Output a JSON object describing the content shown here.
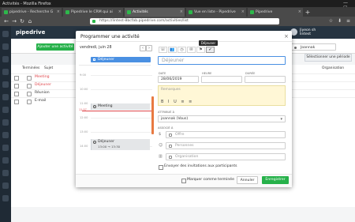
{
  "window": {
    "title": "Activités - Mozilla Firefox",
    "controls": "— ▢ ✕"
  },
  "tabs": [
    {
      "label": "pipedrive - Recherche G"
    },
    {
      "label": "Pipedrive le CRM qui ai"
    },
    {
      "label": "Activités"
    },
    {
      "label": "Vue en liste - Pipedrive"
    },
    {
      "label": "Pipedrive"
    }
  ],
  "url": "https://lintest-8bcfab.pipedrive.com/activities/list",
  "nav": {
    "back": "←",
    "forward": "→",
    "reload": "↻",
    "home": "⌂",
    "tools": "☆ ⬇ ≡"
  },
  "app": {
    "logo": "pipedrive",
    "user": {
      "name": "Jiyeon sh",
      "company": "lintest"
    },
    "add_activity": "Ajouter une activité",
    "filter_label": "Joannak",
    "period_label": "Sélectionner une période",
    "columns": {
      "done": "Terminées",
      "subject": "Sujet",
      "org": "Organisation"
    },
    "rows": [
      {
        "subject": "Meeting",
        "red": true
      },
      {
        "subject": "Déjeuner",
        "red": true
      },
      {
        "subject": "Réunion",
        "red": false
      },
      {
        "subject": "E-mail",
        "red": false
      }
    ]
  },
  "modal": {
    "title": "Programmer une activité",
    "close": "×",
    "date_label": "vendredi, juin 28",
    "prev": "‹",
    "next": "›",
    "allday_event": "Déjeuner",
    "hours": [
      "9:00",
      "10:00",
      "11:00",
      "12:00",
      "13:00",
      "14:00"
    ],
    "now_label": "11:57",
    "events": [
      {
        "title": "Meeting"
      },
      {
        "title": "Déjeuner",
        "time": "13:00 → 13:30"
      }
    ],
    "tooltip": "Déjeuner",
    "types": [
      "☏",
      "👥",
      "◷",
      "✉",
      "⚑",
      "✔"
    ],
    "subject_placeholder": "Déjeuner",
    "date_field_label": "DATE",
    "date_value": "28/06/2019",
    "time_field_label": "HEURE",
    "duration_field_label": "DURÉE",
    "notes_placeholder": "Remarques",
    "format_tools": "B I U ≡ ≡",
    "assigned_label": "ATTRIBUÉ À",
    "owner": "joannak (Vous)",
    "linked_label": "ASSOCIÉ À",
    "deal_placeholder": "Offre",
    "person_placeholder": "Personnes",
    "org_placeholder": "Organisation",
    "send_invites": "Envoyer des invitations aux participants",
    "mark_done": "Marquer comme terminée",
    "cancel": "Annuler",
    "save": "Enregistrer"
  }
}
